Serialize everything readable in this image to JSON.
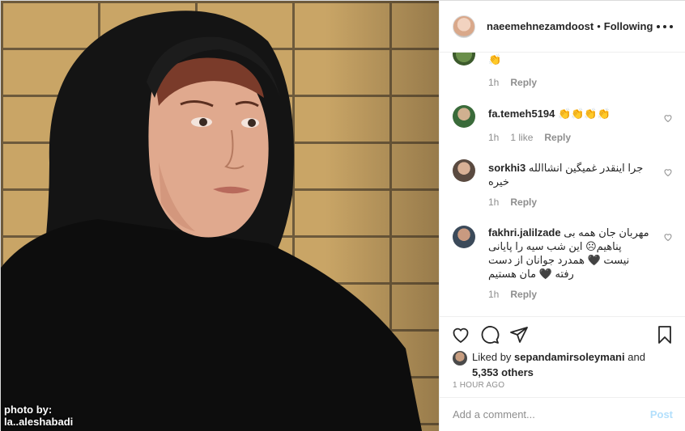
{
  "header": {
    "username": "naeemehnezamdoost",
    "separator": "•",
    "follow_status": "Following"
  },
  "photo": {
    "credit_line1": "photo by:",
    "credit_line2": "la..aleshabadi"
  },
  "comments": [
    {
      "username": "",
      "text": "👏",
      "time": "1h",
      "likes": "",
      "reply": "Reply"
    },
    {
      "username": "fa.temeh5194",
      "text": "👏👏👏👏",
      "time": "1h",
      "likes": "1 like",
      "reply": "Reply"
    },
    {
      "username": "sorkhi3",
      "text": "جرا اینقدر غمیگین انشاالله خیره",
      "time": "1h",
      "likes": "",
      "reply": "Reply"
    },
    {
      "username": "fakhri.jalilzade",
      "text": "مهربان جان همه بی پناهیم☹ این شب سیه را پایانی نیست 🖤 همدرد جوانان از دست رفته 🖤 مان هستیم",
      "time": "1h",
      "likes": "",
      "reply": "Reply"
    }
  ],
  "likes": {
    "prefix": "Liked by",
    "user": "sepandamirsoleymani",
    "conjunction": "and",
    "others": "5,353 others"
  },
  "timestamp": "1 HOUR AGO",
  "add_comment": {
    "placeholder": "Add a comment...",
    "post_label": "Post"
  },
  "icons": [
    "heart-icon",
    "comment-icon",
    "share-icon",
    "bookmark-icon",
    "more-icon"
  ],
  "colors": {
    "text": "#262626",
    "muted": "#8e8e8e",
    "post_button": "#b2dffc",
    "border": "#dbdbdb"
  }
}
